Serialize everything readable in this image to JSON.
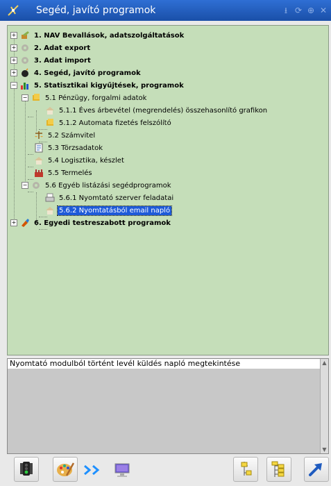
{
  "window": {
    "title": "Segéd, javító programok",
    "title_bar_color": "#1f5bbf",
    "title_buttons": [
      "pin-icon",
      "restore-icon",
      "zoom-icon",
      "close-icon"
    ]
  },
  "tree": {
    "background": "#c5deb9",
    "selection_color": "#1e5ad8",
    "items": [
      {
        "label": "1. NAV Bevallások, adatszolgáltatások",
        "icon": "tools-icon",
        "expander": "+"
      },
      {
        "label": "2. Adat export",
        "icon": "gear-icon",
        "expander": "+"
      },
      {
        "label": "3. Adat import",
        "icon": "gear-icon",
        "expander": "+"
      },
      {
        "label": "4. Segéd, javító programok",
        "icon": "bomb-icon",
        "expander": "+"
      },
      {
        "label": "5. Statisztikai kigyűjtések, programok",
        "icon": "bar-chart-icon",
        "expander": "−"
      },
      {
        "label": "5.1 Pénzügy, forgalmi adatok",
        "icon": "money-icon",
        "expander": "−"
      },
      {
        "label": "5.1.1 Éves árbevétel (megrendelés) összehasonlító grafikon",
        "icon": "house-icon"
      },
      {
        "label": "5.1.2 Automata fizetés felszólító",
        "icon": "money-icon"
      },
      {
        "label": "5.2 Számvitel",
        "icon": "scales-icon"
      },
      {
        "label": "5.3 Törzsadatok",
        "icon": "document-icon"
      },
      {
        "label": "5.4 Logisztika, készlet",
        "icon": "house-icon"
      },
      {
        "label": "5.5 Termelés",
        "icon": "factory-icon"
      },
      {
        "label": "5.6 Egyéb listázási segédprogramok",
        "icon": "gear-icon",
        "expander": "−"
      },
      {
        "label": "5.6.1 Nyomtató szerver feladatai",
        "icon": "printer-icon"
      },
      {
        "label": "5.6.2 Nyomtatásból email napló",
        "icon": "house-icon",
        "selected": true
      },
      {
        "label": "6. Egyedi testreszabott programok",
        "icon": "custom-icon",
        "expander": "+"
      }
    ]
  },
  "description": {
    "text": "Nyomtató modulból történt levél küldés napló megtekintése"
  },
  "toolbar": {
    "buttons": [
      "traffic-light-icon",
      "palette-icon",
      "forward-icon",
      "monitor-icon",
      "expand-one-icon",
      "expand-all-icon",
      "run-arrow-icon"
    ]
  }
}
